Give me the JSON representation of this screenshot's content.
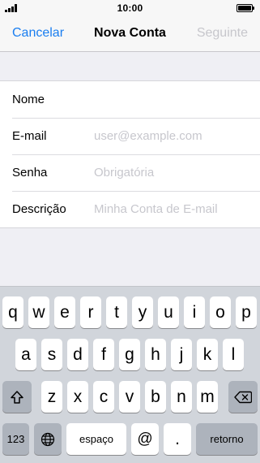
{
  "status_bar": {
    "time": "10:00"
  },
  "nav": {
    "cancel_label": "Cancelar",
    "title": "Nova Conta",
    "next_label": "Seguinte"
  },
  "form": {
    "rows": [
      {
        "label": "Nome",
        "value": "",
        "placeholder": ""
      },
      {
        "label": "E-mail",
        "value": "",
        "placeholder": "user@example.com"
      },
      {
        "label": "Senha",
        "value": "",
        "placeholder": "Obrigatória"
      },
      {
        "label": "Descrição",
        "value": "",
        "placeholder": "Minha Conta de E-mail"
      }
    ]
  },
  "keyboard": {
    "row1": [
      "q",
      "w",
      "e",
      "r",
      "t",
      "y",
      "u",
      "i",
      "o",
      "p"
    ],
    "row2": [
      "a",
      "s",
      "d",
      "f",
      "g",
      "h",
      "j",
      "k",
      "l"
    ],
    "row3": [
      "z",
      "x",
      "c",
      "v",
      "b",
      "n",
      "m"
    ],
    "numbers_label": "123",
    "space_label": "espaço",
    "at_label": "@",
    "dot_label": ".",
    "return_label": "retorno",
    "shift_icon": "shift-icon",
    "globe_icon": "globe-icon",
    "delete_icon": "delete-icon"
  },
  "colors": {
    "accent": "#1a7ef0",
    "disabled": "#c7c7cc",
    "keyboard_bg": "#d1d5db",
    "function_key": "#adb3bc"
  }
}
